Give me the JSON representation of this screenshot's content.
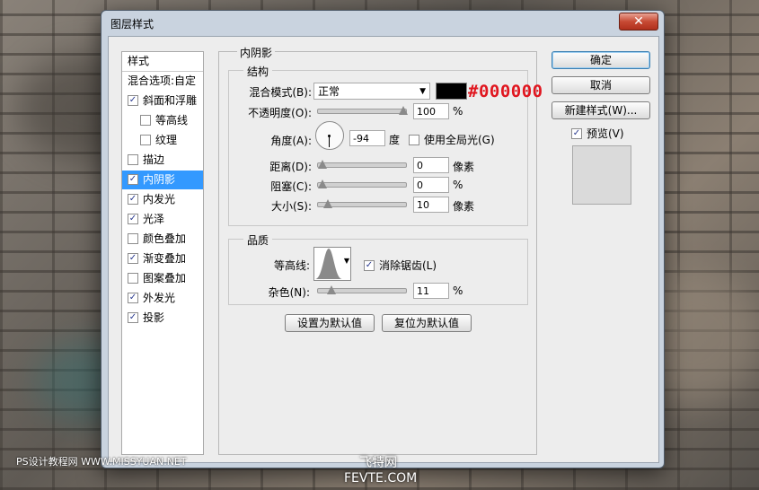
{
  "window": {
    "title": "图层样式",
    "close_label": "✕"
  },
  "left_panel": {
    "header": "样式",
    "items": [
      {
        "label": "混合选项:自定",
        "checkbox": false,
        "checked": false,
        "indent": 0,
        "selected": false
      },
      {
        "label": "斜面和浮雕",
        "checkbox": true,
        "checked": true,
        "indent": 0,
        "selected": false
      },
      {
        "label": "等高线",
        "checkbox": true,
        "checked": false,
        "indent": 1,
        "selected": false
      },
      {
        "label": "纹理",
        "checkbox": true,
        "checked": false,
        "indent": 1,
        "selected": false
      },
      {
        "label": "描边",
        "checkbox": true,
        "checked": false,
        "indent": 0,
        "selected": false
      },
      {
        "label": "内阴影",
        "checkbox": true,
        "checked": true,
        "indent": 0,
        "selected": true
      },
      {
        "label": "内发光",
        "checkbox": true,
        "checked": true,
        "indent": 0,
        "selected": false
      },
      {
        "label": "光泽",
        "checkbox": true,
        "checked": true,
        "indent": 0,
        "selected": false
      },
      {
        "label": "颜色叠加",
        "checkbox": true,
        "checked": false,
        "indent": 0,
        "selected": false
      },
      {
        "label": "渐变叠加",
        "checkbox": true,
        "checked": true,
        "indent": 0,
        "selected": false
      },
      {
        "label": "图案叠加",
        "checkbox": true,
        "checked": false,
        "indent": 0,
        "selected": false
      },
      {
        "label": "外发光",
        "checkbox": true,
        "checked": true,
        "indent": 0,
        "selected": false
      },
      {
        "label": "投影",
        "checkbox": true,
        "checked": true,
        "indent": 0,
        "selected": false
      }
    ]
  },
  "main": {
    "group_title": "内阴影",
    "structure": {
      "title": "结构",
      "blend_mode_label": "混合模式(B):",
      "blend_mode_value": "正常",
      "color_hex": "#000000",
      "color_annotation": "#000000",
      "opacity_label": "不透明度(O):",
      "opacity_value": "100",
      "opacity_unit": "%",
      "opacity_fraction": 1.0,
      "angle_label": "角度(A):",
      "angle_value": "-94",
      "angle_unit": "度",
      "global_light_label": "使用全局光(G)",
      "global_light_checked": false,
      "distance_label": "距离(D):",
      "distance_value": "0",
      "distance_unit": "像素",
      "distance_fraction": 0.0,
      "choke_label": "阻塞(C):",
      "choke_value": "0",
      "choke_unit": "%",
      "choke_fraction": 0.0,
      "size_label": "大小(S):",
      "size_value": "10",
      "size_unit": "像素",
      "size_fraction": 0.07
    },
    "quality": {
      "title": "品质",
      "contour_label": "等高线:",
      "anti_alias_label": "消除锯齿(L)",
      "anti_alias_checked": true,
      "noise_label": "杂色(N):",
      "noise_value": "11",
      "noise_unit": "%",
      "noise_fraction": 0.11
    },
    "make_default_label": "设置为默认值",
    "reset_default_label": "复位为默认值"
  },
  "right": {
    "ok_label": "确定",
    "cancel_label": "取消",
    "new_style_label": "新建样式(W)...",
    "preview_label": "预览(V)",
    "preview_checked": true
  },
  "watermarks": {
    "left": "PS设计教程网  WWW.MISSYUAN.NET",
    "center_cn": "飞特网",
    "center_en": "FEVTE.COM"
  }
}
